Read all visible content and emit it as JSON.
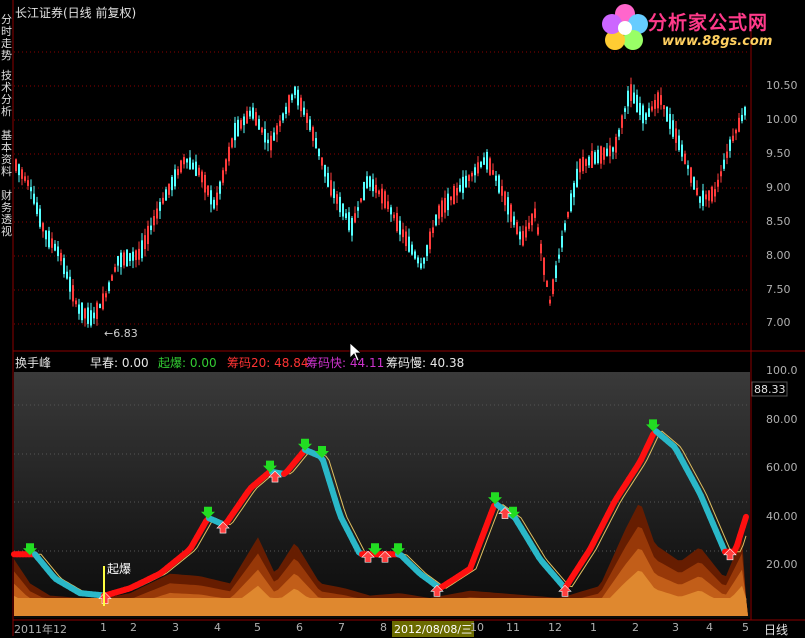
{
  "window": {
    "title": "长江证券(日线 前复权)"
  },
  "side_tabs": [
    "分时走势",
    "技术分析",
    "基本资料",
    "财务透视"
  ],
  "logo": {
    "text": "分析家公式网",
    "url_text": "www.88gs.com"
  },
  "price_panel": {
    "y_ticks": [
      "10.50",
      "10.00",
      "9.50",
      "9.00",
      "8.50",
      "8.00",
      "7.50",
      "7.00"
    ],
    "low_marker": "6.83"
  },
  "indicator_panel": {
    "name": "换手峰",
    "legend": [
      {
        "label": "早春:",
        "value": "0.00",
        "color": "#e8e8e8"
      },
      {
        "label": "起爆:",
        "value": "0.00",
        "color": "#33cc33"
      },
      {
        "label": "筹码20:",
        "value": "48.84",
        "color": "#ff3333"
      },
      {
        "label": "筹码快:",
        "value": "44.11",
        "color": "#cc33cc"
      },
      {
        "label": "筹码慢:",
        "value": "40.38",
        "color": "#e8e8e8"
      }
    ],
    "y_ticks": [
      "100.0",
      "80.00",
      "60.00",
      "40.00",
      "20.00"
    ],
    "current_value": "88.33",
    "annotation": "起爆"
  },
  "time_axis": {
    "labels": [
      "2011年12",
      "1",
      "2",
      "3",
      "4",
      "5",
      "6",
      "7",
      "8",
      "2012/08/08/三",
      "10",
      "11",
      "12",
      "1",
      "2",
      "3",
      "4",
      "5"
    ],
    "period": "日线"
  },
  "colors": {
    "up": "#ff3b3b",
    "down": "#54ffff",
    "grid": "#8b0000",
    "fast_line": "#ff1010",
    "slow_line": "#2ab8c8",
    "area": "#d8781e"
  }
}
